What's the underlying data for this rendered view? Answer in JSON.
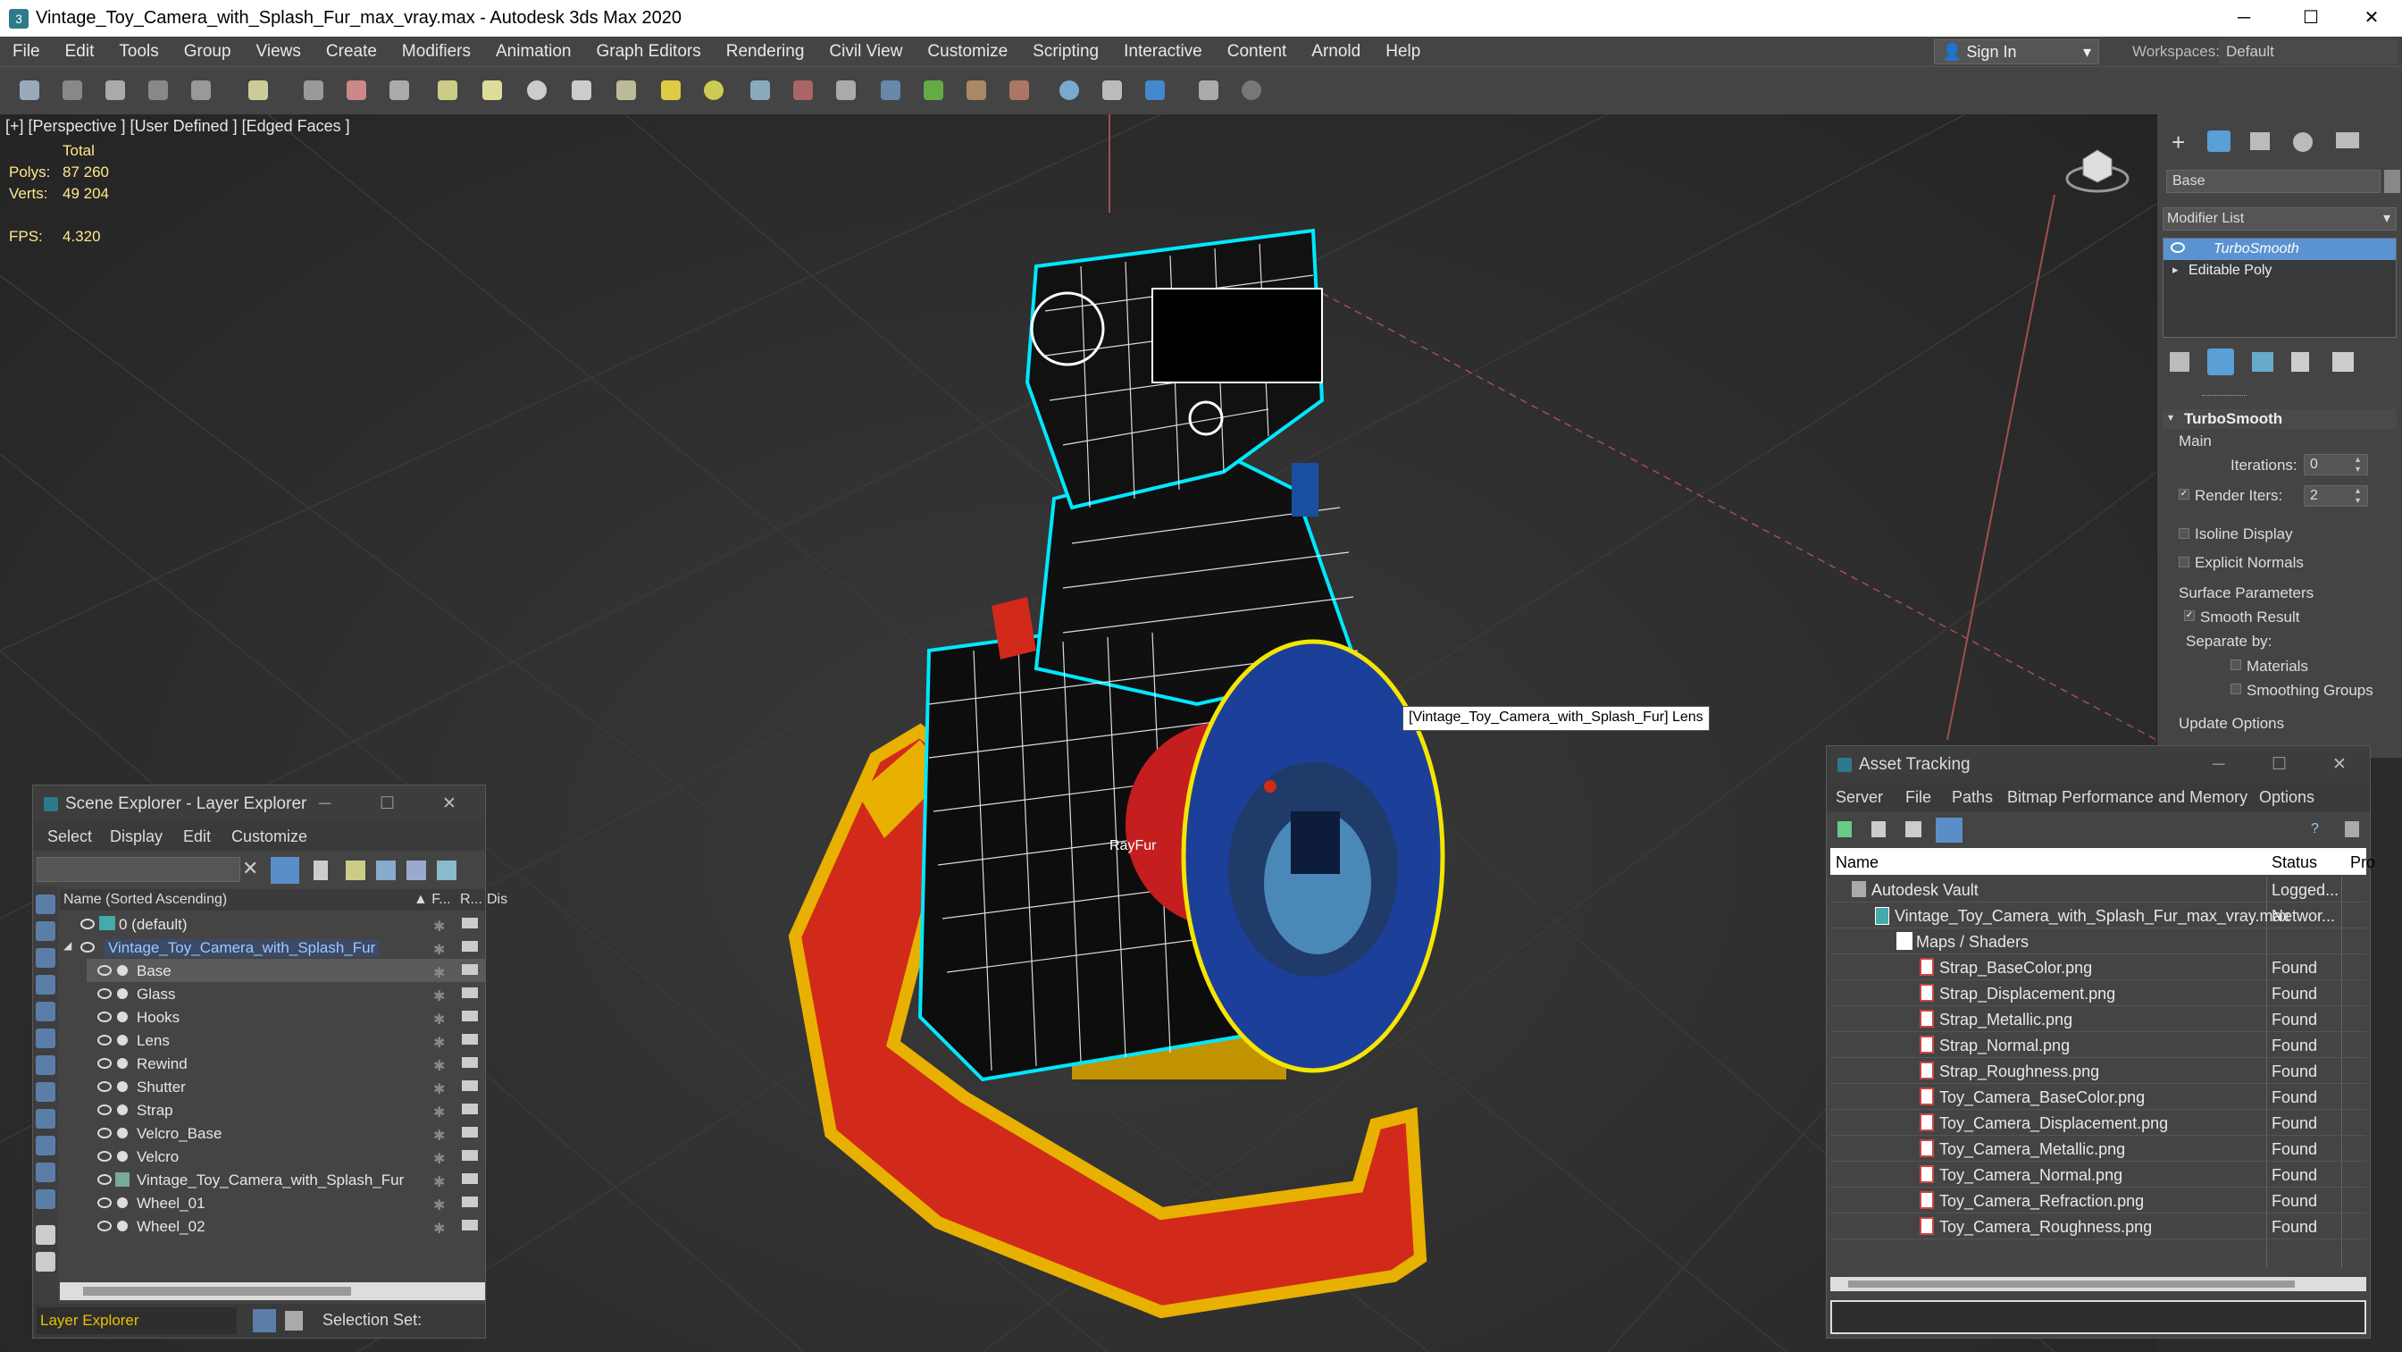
{
  "window": {
    "title": "Vintage_Toy_Camera_with_Splash_Fur_max_vray.max - Autodesk 3ds Max 2020",
    "minimize": "─",
    "maximize": "☐",
    "close": "✕"
  },
  "menu": [
    "File",
    "Edit",
    "Tools",
    "Group",
    "Views",
    "Create",
    "Modifiers",
    "Animation",
    "Graph Editors",
    "Rendering",
    "Civil View",
    "Customize",
    "Scripting",
    "Interactive",
    "Content",
    "Arnold",
    "Help"
  ],
  "signin": {
    "label": "Sign In"
  },
  "workspace": {
    "label": "Workspaces:",
    "value": "Default"
  },
  "viewport": {
    "label": "[+] [Perspective ] [User Defined ] [Edged Faces ]",
    "stats": {
      "total": "Total",
      "polys_label": "Polys:",
      "polys": "87 260",
      "verts_label": "Verts:",
      "verts": "49 204",
      "fps_label": "FPS:",
      "fps": "4.320"
    },
    "tooltip": "[Vintage_Toy_Camera_with_Splash_Fur] Lens",
    "rayfur_label": "RayFur"
  },
  "command_panel": {
    "object_name": "Base",
    "modifier_list": "Modifier List",
    "stack": [
      "TurboSmooth",
      "Editable Poly"
    ],
    "rollout": "TurboSmooth",
    "main": "Main",
    "iterations_label": "Iterations:",
    "iterations": "0",
    "render_iters_label": "Render Iters:",
    "render_iters": "2",
    "isoline": "Isoline Display",
    "explicit_normals": "Explicit Normals",
    "surface_params": "Surface Parameters",
    "smooth_result": "Smooth Result",
    "separate_by": "Separate by:",
    "materials": "Materials",
    "smoothing_groups": "Smoothing Groups",
    "update_options": "Update Options"
  },
  "scene_explorer": {
    "title": "Scene Explorer - Layer Explorer",
    "menu": [
      "Select",
      "Display",
      "Edit",
      "Customize"
    ],
    "col_name": "Name (Sorted Ascending)",
    "col_f": "▲ F...",
    "col_r": "R...",
    "col_d": "Dis",
    "rows": [
      {
        "label": "0 (default)",
        "indent": 0
      },
      {
        "label": "Vintage_Toy_Camera_with_Splash_Fur",
        "indent": 0
      },
      {
        "label": "Base",
        "indent": 1
      },
      {
        "label": "Glass",
        "indent": 1
      },
      {
        "label": "Hooks",
        "indent": 1
      },
      {
        "label": "Lens",
        "indent": 1
      },
      {
        "label": "Rewind",
        "indent": 1
      },
      {
        "label": "Shutter",
        "indent": 1
      },
      {
        "label": "Strap",
        "indent": 1
      },
      {
        "label": "Velcro_Base",
        "indent": 1
      },
      {
        "label": "Velcro",
        "indent": 1
      },
      {
        "label": "Vintage_Toy_Camera_with_Splash_Fur",
        "indent": 1
      },
      {
        "label": "Wheel_01",
        "indent": 1
      },
      {
        "label": "Wheel_02",
        "indent": 1
      }
    ],
    "footer_label": "Layer Explorer",
    "selection_set": "Selection Set:"
  },
  "asset_tracking": {
    "title": "Asset Tracking",
    "menu": [
      "Server",
      "File",
      "Paths",
      "Bitmap Performance and Memory",
      "Options"
    ],
    "col_name": "Name",
    "col_status": "Status",
    "col_pro": "Pro",
    "rows": [
      {
        "name": "Autodesk Vault",
        "status": "Logged..."
      },
      {
        "name": "Vintage_Toy_Camera_with_Splash_Fur_max_vray.max",
        "status": "Networ..."
      },
      {
        "name": "Maps / Shaders",
        "status": ""
      },
      {
        "name": "Strap_BaseColor.png",
        "status": "Found"
      },
      {
        "name": "Strap_Displacement.png",
        "status": "Found"
      },
      {
        "name": "Strap_Metallic.png",
        "status": "Found"
      },
      {
        "name": "Strap_Normal.png",
        "status": "Found"
      },
      {
        "name": "Strap_Roughness.png",
        "status": "Found"
      },
      {
        "name": "Toy_Camera_BaseColor.png",
        "status": "Found"
      },
      {
        "name": "Toy_Camera_Displacement.png",
        "status": "Found"
      },
      {
        "name": "Toy_Camera_Metallic.png",
        "status": "Found"
      },
      {
        "name": "Toy_Camera_Normal.png",
        "status": "Found"
      },
      {
        "name": "Toy_Camera_Refraction.png",
        "status": "Found"
      },
      {
        "name": "Toy_Camera_Roughness.png",
        "status": "Found"
      }
    ]
  }
}
